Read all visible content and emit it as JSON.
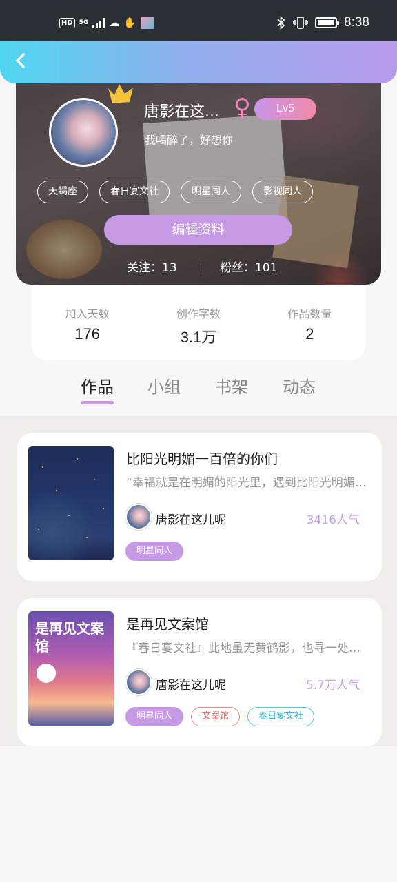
{
  "status_bar": {
    "left_hd": "HD",
    "left_signal_label": "5G",
    "time": "8:38",
    "icons": [
      "hd-icon",
      "signal-icon",
      "cloud-icon",
      "hand-icon",
      "app-thumbnail-icon",
      "bluetooth-icon",
      "vibrate-icon",
      "battery-icon"
    ]
  },
  "header": {
    "back_icon": "chevron-left-icon"
  },
  "profile": {
    "name": "唐影在这...",
    "gender_symbol": "♀",
    "level": "Lv5",
    "bio": "我喝醉了，好想你",
    "tags": [
      "天蝎座",
      "春日宴文社",
      "明星同人",
      "影视同人"
    ],
    "edit_button": "编辑资料",
    "following": "关注：13",
    "followers": "粉丝：101",
    "accent_color": "#c79ae6"
  },
  "stats": [
    {
      "label": "加入天数",
      "value": "176"
    },
    {
      "label": "创作字数",
      "value": "3.1万"
    },
    {
      "label": "作品数量",
      "value": "2"
    }
  ],
  "tabs": [
    {
      "label": "作品",
      "active": true
    },
    {
      "label": "小组",
      "active": false
    },
    {
      "label": "书架",
      "active": false
    },
    {
      "label": "动态",
      "active": false
    }
  ],
  "works": [
    {
      "title": "比阳光明媚一百倍的你们",
      "description": "“幸福就是在明媚的阳光里，遇到比阳光明媚一百倍的你们”",
      "author": "唐影在这儿呢",
      "popularity": "3416人气",
      "tags": [
        "明星同人"
      ]
    },
    {
      "title": "是再见文案馆",
      "description": "『春日宴文社』此地虽无黄鹤影，也寻一处文案馆",
      "author": "唐影在这儿呢",
      "popularity": "5.7万人气",
      "cover_title": "是再见文案馆",
      "tags": [
        "明星同人",
        "文案馆",
        "春日宴文社"
      ]
    }
  ]
}
